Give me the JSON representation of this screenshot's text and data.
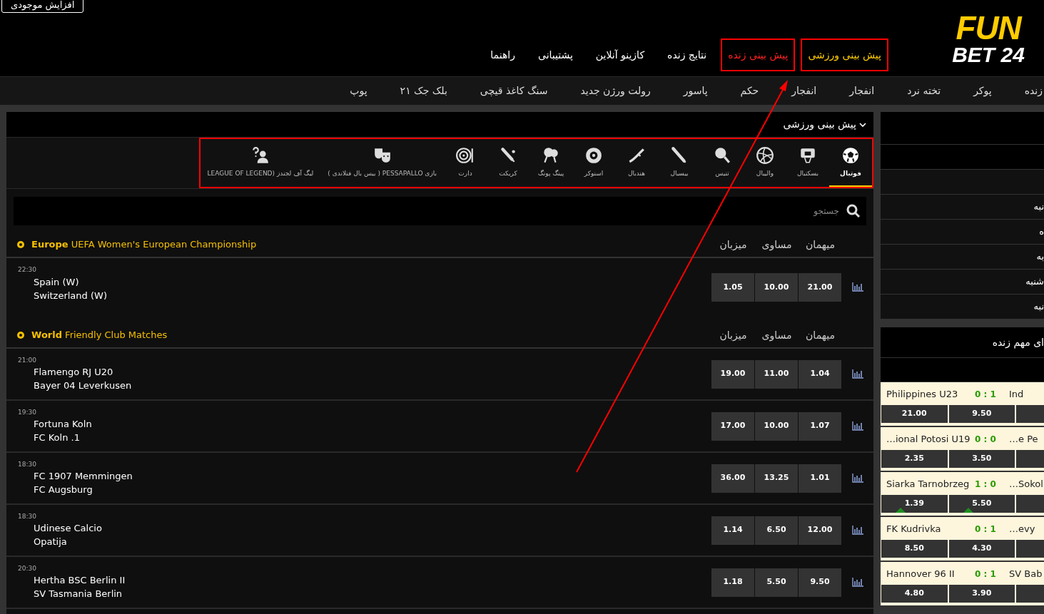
{
  "account": {
    "deposit_button": "افزایش موجودی"
  },
  "logo": {
    "top": "FUN",
    "bottom": "BET 24"
  },
  "nav": [
    {
      "label": "پیش بینی ورزشی",
      "kind": "link",
      "selected": true,
      "highlighted": true
    },
    {
      "label": "پیش بینی زنده",
      "kind": "live",
      "selected": false,
      "highlighted": true
    },
    {
      "label": "نتایج زنده",
      "kind": "link",
      "selected": false,
      "highlighted": false
    },
    {
      "label": "کازینو آنلاین",
      "kind": "link",
      "selected": false,
      "highlighted": false
    },
    {
      "label": "پشتیبانی",
      "kind": "link",
      "selected": false,
      "highlighted": false
    },
    {
      "label": "راهنما",
      "kind": "link",
      "selected": false,
      "highlighted": false
    }
  ],
  "games_bar": [
    "زنده",
    "پوکر",
    "تخته نرد",
    "انفجار",
    "انفجار",
    "حکم",
    "پاسور",
    "رولت ورژن جدید",
    "سنگ کاغذ قیچی",
    "بلک جک ۲۱",
    "پوپ"
  ],
  "section_title": "پیش بینی ورزشی",
  "sports": {
    "highlighted": true,
    "items": [
      {
        "label": "فوتبال",
        "selected": true
      },
      {
        "label": "بسکتبال",
        "selected": false
      },
      {
        "label": "والیبال",
        "selected": false
      },
      {
        "label": "تنیس",
        "selected": false
      },
      {
        "label": "بیسبال",
        "selected": false
      },
      {
        "label": "هندبال",
        "selected": false
      },
      {
        "label": "اسنوکر",
        "selected": false
      },
      {
        "label": "پینگ پونگ",
        "selected": false
      },
      {
        "label": "کریکت",
        "selected": false
      },
      {
        "label": "دارت",
        "selected": false
      },
      {
        "label": "بازی PESSAPALLO ( بیس بال فنلاندی )",
        "selected": false
      },
      {
        "label": "لیگ آف لجندز (LEAGUE OF LEGEND",
        "selected": false
      }
    ]
  },
  "search": {
    "placeholder": "جستجو"
  },
  "groups": [
    {
      "title": "**Europe** UEFA Women's European Championship",
      "columns": [
        "میهمان",
        "مساوی",
        "میزبان"
      ],
      "matches": [
        {
          "time": "22:30",
          "home": "Spain (W)",
          "away": "Switzerland (W)",
          "odds": [
            "21.00",
            "10.00",
            "1.05"
          ]
        }
      ]
    },
    {
      "title": "**World** Friendly Club Matches",
      "columns": [
        "میهمان",
        "مساوی",
        "میزبان"
      ],
      "matches": [
        {
          "time": "21:00",
          "home": "Flamengo RJ U20",
          "away": "Bayer 04 Leverkusen",
          "odds": [
            "1.04",
            "11.00",
            "19.00"
          ]
        },
        {
          "time": "19:30",
          "home": "Fortuna Koln",
          "away": "FC Koln .1",
          "odds": [
            "1.07",
            "10.00",
            "17.00"
          ]
        },
        {
          "time": "18:30",
          "home": "FC 1907 Memmingen",
          "away": "FC Augsburg",
          "odds": [
            "1.01",
            "13.25",
            "36.00"
          ]
        },
        {
          "time": "18:30",
          "home": "Udinese Calcio",
          "away": "Opatija",
          "odds": [
            "12.00",
            "6.50",
            "1.14"
          ]
        },
        {
          "time": "20:30",
          "home": "Hertha BSC Berlin II",
          "away": "SV Tasmania Berlin",
          "odds": [
            "9.50",
            "5.50",
            "1.18"
          ]
        }
      ]
    }
  ],
  "days": [
    "نبه",
    "ه",
    "به",
    "شنبه",
    "نبه"
  ],
  "live": {
    "title": "ای مهم زنده",
    "matches": [
      {
        "home": "Philippines U23",
        "score": "0 : 1",
        "away": "Ind",
        "odds": [
          {
            "value": "9.50",
            "up": false
          },
          {
            "value": "21.00",
            "up": false
          }
        ]
      },
      {
        "home": "…ional Potosi U19",
        "score": "0 : 0",
        "away": "…e Pe",
        "odds": [
          {
            "value": "3.50",
            "up": false
          },
          {
            "value": "2.35",
            "up": false
          }
        ]
      },
      {
        "home": "Siarka Tarnobrzeg",
        "score": "1 : 0",
        "away": "…Sokol",
        "odds": [
          {
            "value": "5.50",
            "up": true
          },
          {
            "value": "1.39",
            "up": true
          }
        ]
      },
      {
        "home": "FK Kudrivka",
        "score": "0 : 1",
        "away": "…evy",
        "odds": [
          {
            "value": "4.30",
            "up": false
          },
          {
            "value": "8.50",
            "up": false
          }
        ]
      },
      {
        "home": "Hannover 96 II",
        "score": "0 : 1",
        "away": "SV Bab",
        "odds": [
          {
            "value": "3.90",
            "up": false
          },
          {
            "value": "4.80",
            "up": false
          }
        ]
      }
    ]
  }
}
